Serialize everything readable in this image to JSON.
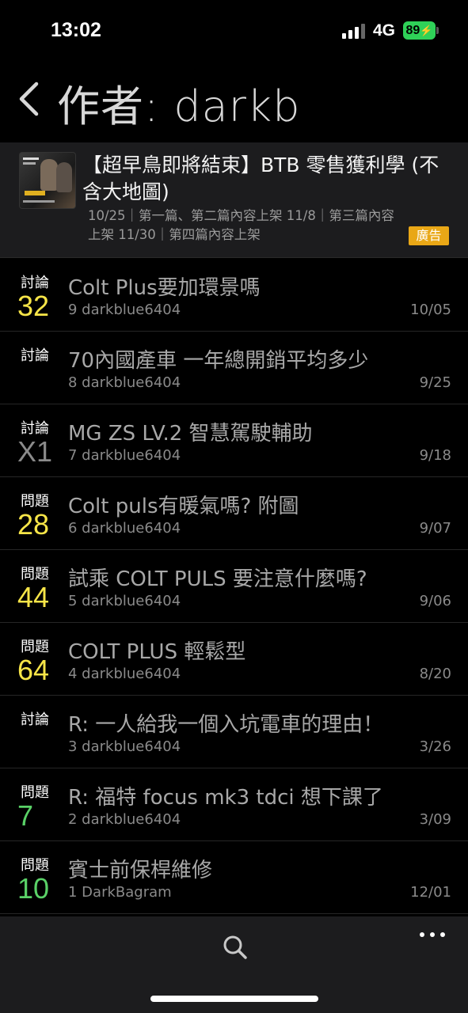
{
  "status_bar": {
    "time": "13:02",
    "network": "4G",
    "battery": "89"
  },
  "header": {
    "title": "作者: darkb"
  },
  "ad": {
    "title": "【超早鳥即將結束】BTB 零售獲利學 (不含大地圖)",
    "description": "10/25｜第一篇、第二篇內容上架 11/8｜第三篇內容上架 11/30｜第四篇內容上架",
    "badge": "廣告"
  },
  "threads": [
    {
      "category": "討論",
      "count": "32",
      "count_color": "yellow",
      "title": "Colt Plus要加環景嗎",
      "meta": "9 darkblue6404",
      "date": "10/05"
    },
    {
      "category": "討論",
      "count": "",
      "count_color": "yellow",
      "title": "70內國產車 一年總開銷平均多少",
      "meta": "8 darkblue6404",
      "date": "9/25"
    },
    {
      "category": "討論",
      "count": "X1",
      "count_color": "gray",
      "title": "MG ZS LV.2 智慧駕駛輔助",
      "meta": "7 darkblue6404",
      "date": "9/18"
    },
    {
      "category": "問題",
      "count": "28",
      "count_color": "yellow",
      "title": "Colt puls有暖氣嗎? 附圖",
      "meta": "6 darkblue6404",
      "date": "9/07"
    },
    {
      "category": "問題",
      "count": "44",
      "count_color": "yellow",
      "title": "試乘 COLT PULS 要注意什麼嗎?",
      "meta": "5 darkblue6404",
      "date": "9/06"
    },
    {
      "category": "問題",
      "count": "64",
      "count_color": "yellow",
      "title": "COLT PLUS 輕鬆型",
      "meta": "4 darkblue6404",
      "date": "8/20"
    },
    {
      "category": "討論",
      "count": "",
      "count_color": "yellow",
      "title": "R: 一人給我一個入坑電車的理由！",
      "meta": "3 darkblue6404",
      "date": "3/26"
    },
    {
      "category": "問題",
      "count": "7",
      "count_color": "green",
      "title": "R: 福特 focus mk3 tdci 想下課了",
      "meta": "2 darkblue6404",
      "date": "3/09"
    },
    {
      "category": "問題",
      "count": "10",
      "count_color": "green",
      "title": "賓士前保桿維修",
      "meta": "1 DarkBagram",
      "date": "12/01"
    }
  ],
  "icons": {
    "back": "chevron-left-icon",
    "search": "search-icon",
    "more": "more-icon"
  },
  "colors": {
    "count_yellow": "#f7e548",
    "count_green": "#5ad167",
    "ad_badge": "#e9a716",
    "battery": "#2fd158"
  }
}
